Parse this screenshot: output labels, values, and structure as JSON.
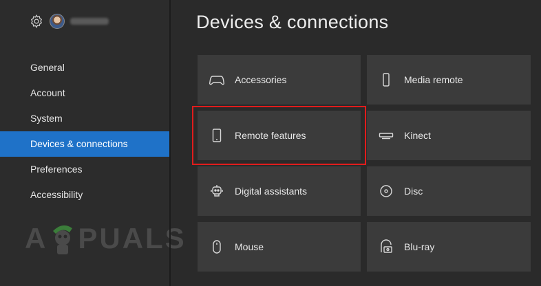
{
  "page": {
    "title": "Devices & connections"
  },
  "profile": {
    "settings_icon": "gear-icon",
    "avatar_icon": "avatar",
    "gamertag": ""
  },
  "sidebar": {
    "items": [
      {
        "label": "General",
        "active": false
      },
      {
        "label": "Account",
        "active": false
      },
      {
        "label": "System",
        "active": false
      },
      {
        "label": "Devices & connections",
        "active": true
      },
      {
        "label": "Preferences",
        "active": false
      },
      {
        "label": "Accessibility",
        "active": false
      }
    ]
  },
  "tiles": [
    {
      "label": "Accessories",
      "icon": "controller-icon"
    },
    {
      "label": "Media remote",
      "icon": "remote-icon"
    },
    {
      "label": "Remote features",
      "icon": "phone-icon"
    },
    {
      "label": "Kinect",
      "icon": "kinect-icon"
    },
    {
      "label": "Digital assistants",
      "icon": "assistant-icon"
    },
    {
      "label": "Disc",
      "icon": "disc-icon"
    },
    {
      "label": "Mouse",
      "icon": "mouse-icon"
    },
    {
      "label": "Blu-ray",
      "icon": "bluray-icon"
    }
  ],
  "watermark": {
    "pre": "A",
    "post": "PUALS"
  },
  "colors": {
    "accent": "#1f72c8",
    "highlight": "#e11c1c",
    "tile": "#3b3b3b",
    "background": "#2a2a2a"
  }
}
